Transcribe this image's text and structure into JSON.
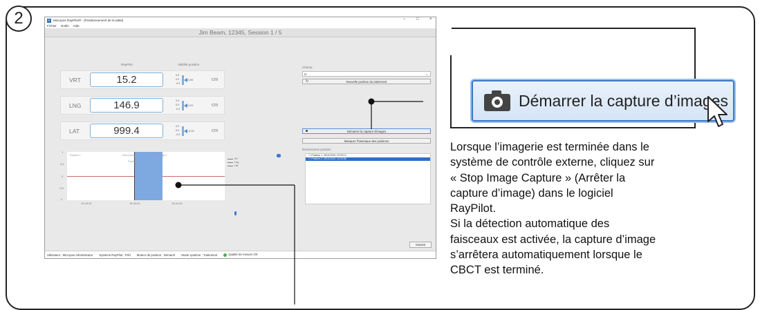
{
  "step_number": "2",
  "app": {
    "title": "Micropos RayPilot® - [Positionnement de la table]",
    "window_controls": [
      "–",
      "□",
      "×"
    ],
    "menu": [
      "Fichier",
      "Outils",
      "Aide"
    ],
    "session": "Jim Beam, 12345, Session 1 / 5",
    "col_raypilot": "RayPilot",
    "col_validite": "Validité position",
    "unit": "cm",
    "axes": [
      {
        "name": "VRT",
        "value": "15.2",
        "gauge_max": "0.3",
        "gauge_mid": "0.0",
        "gauge_min": "-0.3",
        "offset": "0.00"
      },
      {
        "name": "LNG",
        "value": "146.9",
        "gauge_max": "0.3",
        "gauge_mid": "0.0",
        "gauge_min": "-0.3",
        "offset": "0.01"
      },
      {
        "name": "LAT",
        "value": "999.4",
        "gauge_max": "0.3",
        "gauge_mid": "0.0",
        "gauge_min": "-0.3",
        "offset": "-0.03"
      }
    ],
    "plot": {
      "y_ticks": [
        "1",
        "0.5",
        "0",
        "-0.5",
        "-1"
      ],
      "x_ticks": [
        "15:33:30",
        "15:34:00",
        "15:34:30"
      ],
      "labels": [
        "Position 1",
        "Début image 1",
        "Position 2",
        "Fin image 1"
      ],
      "legend": [
        "Vrt",
        "Lng",
        "Lat"
      ]
    },
    "champ_label": "Champ",
    "champ_value": "m",
    "btn_nouvelle": "Nouvelle position du traitement",
    "btn_demarrer": "Démarrer la capture d'images",
    "btn_masquer": "Masquer l'historique des positions",
    "events_label": "Événements position",
    "events": [
      {
        "text": "Position 1: 25/11/2021 15:33:12",
        "selected": false
      },
      {
        "text": "Position 2: 25/11/2021 15:33:58",
        "selected": true
      }
    ],
    "btn_suivant": "Suivant",
    "status": {
      "user": "Utilisateur : Micropos Administrator",
      "system": "Système RayPilot : Prêt",
      "engine": "Moteur de position : Démarré",
      "mode": "Mode système : Traitement",
      "quality": "Qualité de mesure OK"
    }
  },
  "callout": {
    "button_label": "Démarrer la capture d’images",
    "icon": "camera-icon"
  },
  "description": [
    "Lorsque l’imagerie est terminée dans le",
    "système de contrôle externe, cliquez sur",
    "« Stop Image Capture » (Arrêter la",
    "capture d’image) dans le logiciel",
    "RayPilot.",
    "Si la détection automatique des",
    "faisceaux est activée, la capture d’image",
    "s’arrêtera automatiquement lorsque le",
    "CBCT est terminé."
  ],
  "colors": {
    "accent_blue": "#3d78c6",
    "band_blue": "#7ea8e0",
    "status_ok": "#4caf50"
  }
}
